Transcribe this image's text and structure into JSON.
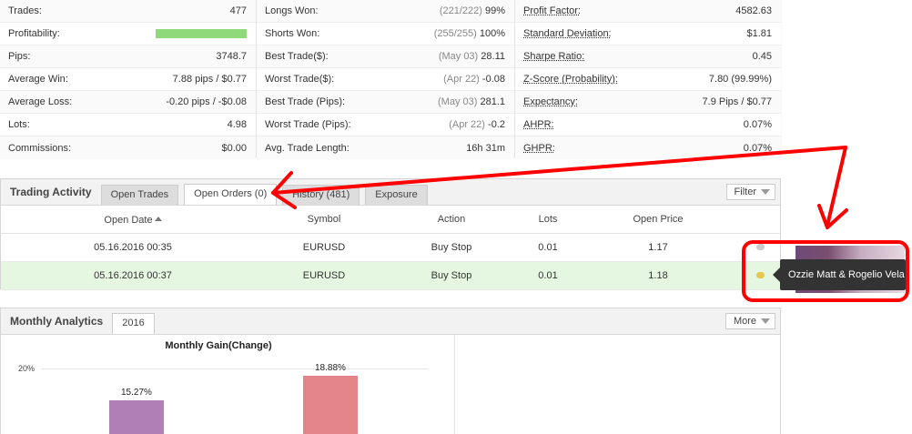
{
  "stats": {
    "col1": [
      {
        "label": "Trades:",
        "value": "477"
      },
      {
        "label": "Profitability:",
        "value": ""
      },
      {
        "label": "Pips:",
        "value": "3748.7"
      },
      {
        "label": "Average Win:",
        "value": "7.88 pips / $0.77"
      },
      {
        "label": "Average Loss:",
        "value": "-0.20 pips / -$0.08"
      },
      {
        "label": "Lots:",
        "value": "4.98"
      },
      {
        "label": "Commissions:",
        "value": "$0.00"
      }
    ],
    "col2": [
      {
        "label": "Longs Won:",
        "grey": "(221/222)",
        "value": "99%"
      },
      {
        "label": "Shorts Won:",
        "grey": "(255/255)",
        "value": "100%"
      },
      {
        "label": "Best Trade($):",
        "grey": "(May 03)",
        "value": "28.11"
      },
      {
        "label": "Worst Trade($):",
        "grey": "(Apr 22)",
        "value": "-0.08"
      },
      {
        "label": "Best Trade (Pips):",
        "grey": "(May 03)",
        "value": "281.1"
      },
      {
        "label": "Worst Trade (Pips):",
        "grey": "(Apr 22)",
        "value": "-0.2"
      },
      {
        "label": "Avg. Trade Length:",
        "grey": "",
        "value": "16h 31m"
      }
    ],
    "col3": [
      {
        "label": "Profit Factor:",
        "value": "4582.63"
      },
      {
        "label": "Standard Deviation:",
        "value": "$1.81"
      },
      {
        "label": "Sharpe Ratio:",
        "value": "0.45"
      },
      {
        "label": "Z-Score (Probability):",
        "value": "7.80 (99.99%)"
      },
      {
        "label": "Expectancy:",
        "value": "7.9 Pips / $0.77"
      },
      {
        "label": "AHPR:",
        "value": "0.07%"
      },
      {
        "label": "GHPR:",
        "value": "0.07%"
      }
    ]
  },
  "activity": {
    "title": "Trading Activity",
    "tabs": [
      "Open Trades",
      "Open Orders (0)",
      "History (481)",
      "Exposure"
    ],
    "filter": "Filter",
    "columns": [
      "Open Date",
      "Symbol",
      "Action",
      "Lots",
      "Open Price"
    ],
    "rows": [
      {
        "date": "05.16.2016 00:35",
        "symbol": "EURUSD",
        "action": "Buy Stop",
        "lots": "0.01",
        "price": "1.17"
      },
      {
        "date": "05.16.2016 00:37",
        "symbol": "EURUSD",
        "action": "Buy Stop",
        "lots": "0.01",
        "price": "1.18"
      }
    ],
    "tooltip": "Ozzie Matt & Rogelio Vela"
  },
  "monthly": {
    "title": "Monthly Analytics",
    "tab": "2016",
    "more": "More"
  },
  "chart_data": {
    "type": "bar",
    "title": "Monthly Gain(Change)",
    "categories": [
      "",
      ""
    ],
    "values": [
      15.27,
      18.88
    ],
    "labels": [
      "15.27%",
      "18.88%"
    ],
    "colors": [
      "#b07fb6",
      "#e4858a"
    ],
    "ytick": "20%",
    "ylim": [
      0,
      20
    ]
  },
  "colors": {
    "profit_bar": "#8fd97a",
    "highlight_row": "#e6f7e1",
    "annotation": "#ff0000"
  }
}
